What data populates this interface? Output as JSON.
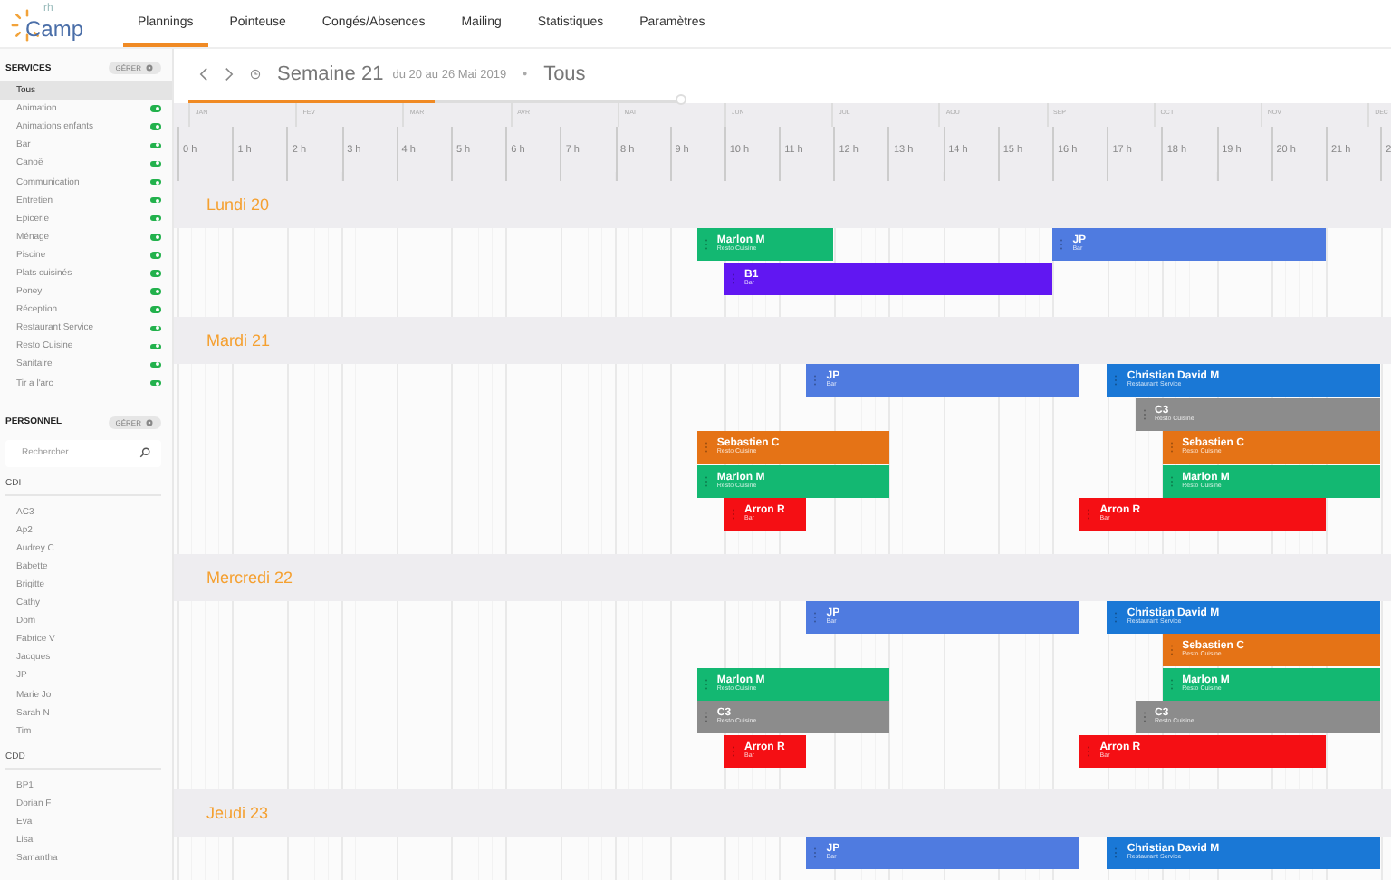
{
  "logo": {
    "small": "rh",
    "main": "Camp"
  },
  "nav": [
    {
      "label": "Plannings",
      "selected": true
    },
    {
      "label": "Pointeuse",
      "selected": false
    },
    {
      "label": "Congés/Absences",
      "selected": false
    },
    {
      "label": "Mailing",
      "selected": false
    },
    {
      "label": "Statistiques",
      "selected": false
    },
    {
      "label": "Paramètres",
      "selected": false
    }
  ],
  "sidebar": {
    "services": {
      "title": "SERVICES",
      "manage": "GÉRER",
      "items": [
        {
          "label": "Tous",
          "selected": true
        },
        {
          "label": "Animation",
          "selected": false,
          "on": true
        },
        {
          "label": "Animations enfants",
          "selected": false,
          "on": true
        },
        {
          "label": "Bar",
          "selected": false,
          "on": true
        },
        {
          "label": "Canoë",
          "selected": false,
          "on": true
        },
        {
          "label": "Communication",
          "selected": false,
          "on": true
        },
        {
          "label": "Entretien",
          "selected": false,
          "on": true
        },
        {
          "label": "Epicerie",
          "selected": false,
          "on": true
        },
        {
          "label": "Ménage",
          "selected": false,
          "on": true
        },
        {
          "label": "Piscine",
          "selected": false,
          "on": true
        },
        {
          "label": "Plats cuisinés",
          "selected": false,
          "on": true
        },
        {
          "label": "Poney",
          "selected": false,
          "on": true
        },
        {
          "label": "Réception",
          "selected": false,
          "on": true
        },
        {
          "label": "Restaurant Service",
          "selected": false,
          "on": true
        },
        {
          "label": "Resto Cuisine",
          "selected": false,
          "on": true
        },
        {
          "label": "Sanitaire",
          "selected": false,
          "on": true
        },
        {
          "label": "Tir a l'arc",
          "selected": false,
          "on": true
        }
      ]
    },
    "staff": {
      "title": "PERSONNEL",
      "manage": "GÉRER",
      "search": {
        "placeholder": "Rechercher"
      },
      "groups": [
        {
          "name": "CDI",
          "members": [
            "AC3",
            "Ap2",
            "Audrey C",
            "Babette",
            "Brigitte",
            "Cathy",
            "Dom",
            "Fabrice V",
            "Jacques",
            "JP",
            "Marie Jo",
            "Sarah N",
            "Tim"
          ]
        },
        {
          "name": "CDD",
          "members": [
            "BP1",
            "Dorian F",
            "Eva",
            "Lisa",
            "Samantha"
          ]
        }
      ]
    }
  },
  "toolbar": {
    "week": "Semaine 21",
    "range": "du 20 au 26 Mai 2019",
    "separator": "•",
    "filter": "Tous",
    "progress": {
      "level": 0.5
    }
  },
  "months": [
    "JAN",
    "FEV",
    "MAR",
    "AVR",
    "MAI",
    "JUN",
    "JUL",
    "AOU",
    "SEP",
    "OCT",
    "NOV",
    "DEC"
  ],
  "hours": [
    "0 h",
    "1 h",
    "2 h",
    "3 h",
    "4 h",
    "5 h",
    "6 h",
    "7 h",
    "8 h",
    "9 h",
    "10 h",
    "11 h",
    "12 h",
    "13 h",
    "14 h",
    "15 h",
    "16 h",
    "17 h",
    "18 h",
    "19 h",
    "20 h",
    "21 h",
    "2"
  ],
  "days": [
    {
      "label": "Lundi 20",
      "lanes": [
        [
          {
            "name": "Marlon M",
            "service": "Resto Cuisine",
            "color": "#13b872"
          },
          {
            "name": "JP",
            "service": "Bar",
            "color": "#4f7be0"
          }
        ],
        [
          {
            "name": "B1",
            "service": "Bar",
            "color": "#6117f2"
          }
        ]
      ]
    },
    {
      "label": "Mardi 21",
      "lanes": [
        [
          {
            "name": "JP",
            "service": "Bar",
            "color": "#4f7be0"
          },
          {
            "name": "Christian David M",
            "service": "Restaurant Service",
            "color": "#1a78d6"
          }
        ],
        [
          {
            "name": "C3",
            "service": "Resto Cuisine",
            "color": "#8c8c8c"
          }
        ],
        [
          {
            "name": "Sebastien C",
            "service": "Resto Cuisine",
            "color": "#e57316"
          },
          {
            "name": "Sebastien C",
            "service": "Resto Cuisine",
            "color": "#e57316"
          }
        ],
        [
          {
            "name": "Marlon M",
            "service": "Resto Cuisine",
            "color": "#13b872"
          },
          {
            "name": "Marlon M",
            "service": "Resto Cuisine",
            "color": "#13b872"
          }
        ],
        [
          {
            "name": "Arron R",
            "service": "Bar",
            "color": "#f50f14"
          },
          {
            "name": "Arron R",
            "service": "Bar",
            "color": "#f50f14"
          }
        ]
      ]
    },
    {
      "label": "Mercredi 22",
      "lanes": [
        [
          {
            "name": "JP",
            "service": "Bar",
            "color": "#4f7be0"
          },
          {
            "name": "Christian David M",
            "service": "Restaurant Service",
            "color": "#1a78d6"
          }
        ],
        [
          {
            "name": "Sebastien C",
            "service": "Resto Cuisine",
            "color": "#e57316"
          }
        ],
        [
          {
            "name": "Marlon M",
            "service": "Resto Cuisine",
            "color": "#13b872"
          },
          {
            "name": "Marlon M",
            "service": "Resto Cuisine",
            "color": "#13b872"
          }
        ],
        [
          {
            "name": "C3",
            "service": "Resto Cuisine",
            "color": "#8c8c8c"
          },
          {
            "name": "C3",
            "service": "Resto Cuisine",
            "color": "#8c8c8c"
          }
        ],
        [
          {
            "name": "Arron R",
            "service": "Bar",
            "color": "#f50f14"
          },
          {
            "name": "Arron R",
            "service": "Bar",
            "color": "#f50f14"
          }
        ]
      ]
    },
    {
      "label": "Jeudi 23",
      "lanes": [
        [
          {
            "name": "JP",
            "service": "Bar",
            "color": "#4f7be0"
          },
          {
            "name": "Christian David M",
            "service": "Restaurant Service",
            "color": "#1a78d6"
          }
        ]
      ]
    }
  ]
}
